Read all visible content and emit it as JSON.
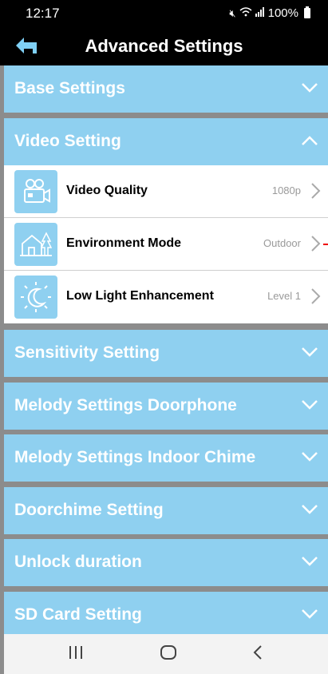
{
  "status_bar": {
    "time": "12:17",
    "battery": "100%",
    "icons": [
      "mute-icon",
      "wifi-icon",
      "signal-icon",
      "battery-icon"
    ]
  },
  "app_bar": {
    "title": "Advanced Settings",
    "back_icon": "back-arrow-icon"
  },
  "sections": [
    {
      "label": "Base Settings",
      "expanded": false
    },
    {
      "label": "Video Setting",
      "expanded": true,
      "items": [
        {
          "label": "Video Quality",
          "value": "1080p",
          "icon": "video-camera-icon"
        },
        {
          "label": "Environment Mode",
          "value": "Outdoor",
          "icon": "house-tree-icon"
        },
        {
          "label": "Low Light Enhancement",
          "value": "Level 1",
          "icon": "moon-sun-icon"
        }
      ]
    },
    {
      "label": "Sensitivity Setting",
      "expanded": false
    },
    {
      "label": "Melody Settings Doorphone",
      "expanded": false
    },
    {
      "label": "Melody Settings Indoor Chime",
      "expanded": false
    },
    {
      "label": "Doorchime Setting",
      "expanded": false
    },
    {
      "label": "Unlock duration",
      "expanded": false
    },
    {
      "label": "SD Card Setting",
      "expanded": false
    }
  ],
  "colors": {
    "section_bg": "#8fd0f0",
    "separator": "#8c8c8c",
    "app_bar": "#000000",
    "value_text": "#9a9a9a"
  },
  "nav_bar": {
    "icons": [
      "recent-apps-icon",
      "home-icon",
      "back-icon"
    ]
  }
}
